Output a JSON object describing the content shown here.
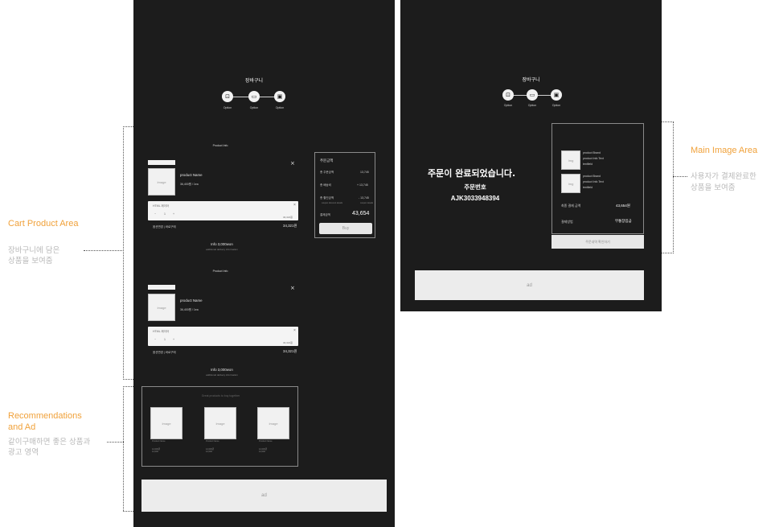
{
  "annotations": {
    "cart_title": "Cart Product  Area",
    "cart_desc": [
      "장바구니에 담은",
      "상품을 보여줌"
    ],
    "rec_title": [
      "Recommendations",
      "and Ad"
    ],
    "rec_desc": [
      "같이구매하면 좋은 상품과",
      "광고 영역"
    ],
    "main_title": "Main Image  Area",
    "main_desc": [
      "사용자가 결제완료한",
      "상품을 보여줌"
    ]
  },
  "cart_screen": {
    "title": "장바구니",
    "steps": [
      {
        "icon": "cart-icon",
        "glyph": "⊡",
        "label": "Option"
      },
      {
        "icon": "card-icon",
        "glyph": "▭",
        "label": "Option"
      },
      {
        "icon": "receipt-icon",
        "glyph": "▣",
        "label": "Option"
      }
    ],
    "products": [
      {
        "section_label": "Product Info",
        "image_label": "Image",
        "name": "product Name",
        "price_line": "36,400원 / 1ea",
        "close": "×",
        "option_label": "HTML 제이아",
        "option_close": "×",
        "qty_minus": "−",
        "qty": "1",
        "qty_plus": "+",
        "option_price": "34,321원",
        "footer_left": "옵션변경 | 바로구매",
        "footer_price": "34,321원",
        "info_main": "Info  3,000won",
        "info_sub": "additional delivery information"
      },
      {
        "section_label": "Product Info",
        "image_label": "Image",
        "name": "product Name",
        "price_line": "36,400원 / 1ea",
        "close": "×",
        "option_label": "HTML 제이아",
        "option_close": "×",
        "qty_minus": "−",
        "qty": "1",
        "qty_plus": "+",
        "option_price": "34,321원",
        "footer_left": "옵션변경 | 바로구매",
        "footer_price": "34,321원",
        "info_main": "Info  3,000won",
        "info_sub": "additional delivery information"
      }
    ],
    "summary": {
      "title": "주문금액",
      "rows": [
        {
          "label": "총 주문금액",
          "value": "13,745"
        },
        {
          "label": "총 배송비",
          "value": "+ 13,745"
        },
        {
          "label": "총 할인금액",
          "value": "- 13,745"
        }
      ],
      "discount_note_left": "coupon discount details",
      "discount_note_right": "coupon details",
      "total_label": "결제금액",
      "total_value": "43,654",
      "buy_label": "Buy"
    },
    "recommend": {
      "heading": "Great products to buy together",
      "items": [
        {
          "image_label": "Image",
          "caption": "Product Name",
          "price": "12,000원",
          "sub": "12,000"
        },
        {
          "image_label": "Image",
          "caption": "Product Name",
          "price": "12,000원",
          "sub": "12,000"
        },
        {
          "image_label": "Image",
          "caption": "Product Name",
          "price": "12,000원",
          "sub": "12,000"
        }
      ]
    },
    "ad_label": "ad"
  },
  "complete_screen": {
    "title": "장바구니",
    "steps": [
      {
        "icon": "cart-icon",
        "glyph": "⊡",
        "label": "Option"
      },
      {
        "icon": "card-icon",
        "glyph": "▭",
        "label": "Option"
      },
      {
        "icon": "receipt-icon",
        "glyph": "▣",
        "label": "Option"
      }
    ],
    "headline": "주문이 완료되었습니다.",
    "order_label": "주문번호",
    "order_number": "AJK3033948394",
    "items": [
      {
        "image_label": "Img",
        "lines": [
          "product Brand",
          "product Info Text",
          "textfield"
        ]
      },
      {
        "image_label": "Img",
        "lines": [
          "product Brand",
          "product Info Text",
          "textfield"
        ]
      }
    ],
    "final_label": "최종 결제 금액",
    "final_value": "43,654원",
    "method_label": "결제방법",
    "method_value": "무통장입금",
    "confirm_button": "주문내역 확인하기",
    "ad_label": "ad"
  }
}
